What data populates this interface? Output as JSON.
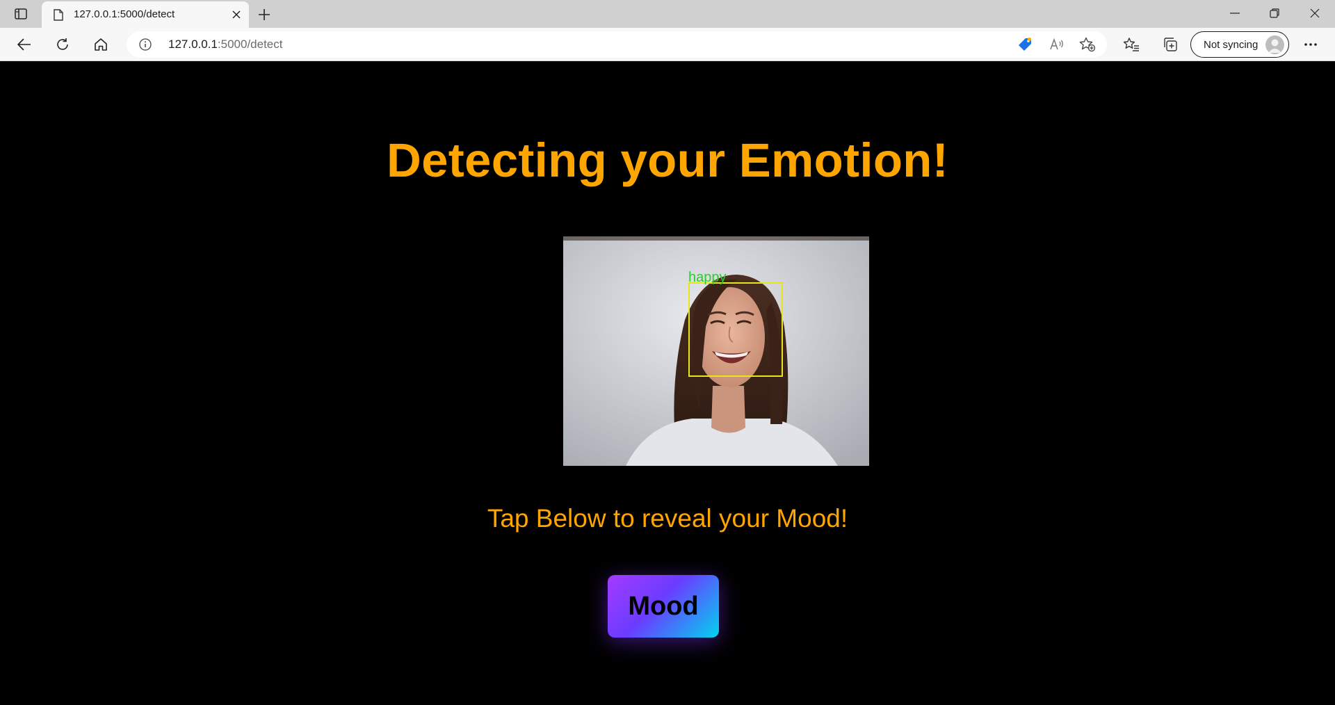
{
  "browser": {
    "tab": {
      "title": "127.0.0.1:5000/detect",
      "favicon": "page-icon"
    },
    "address": {
      "host": "127.0.0.1",
      "path": ":5000/detect"
    },
    "profile": {
      "label": "Not syncing"
    }
  },
  "page": {
    "headline": "Detecting your Emotion!",
    "video": {
      "emotion_label": "happy",
      "box_color": "#e6e61a",
      "label_color": "#2ecc2e"
    },
    "subtitle": "Tap Below to reveal your Mood!",
    "mood_button": {
      "label": "Mood"
    }
  },
  "colors": {
    "accent": "#ffa500",
    "background": "#000000"
  }
}
